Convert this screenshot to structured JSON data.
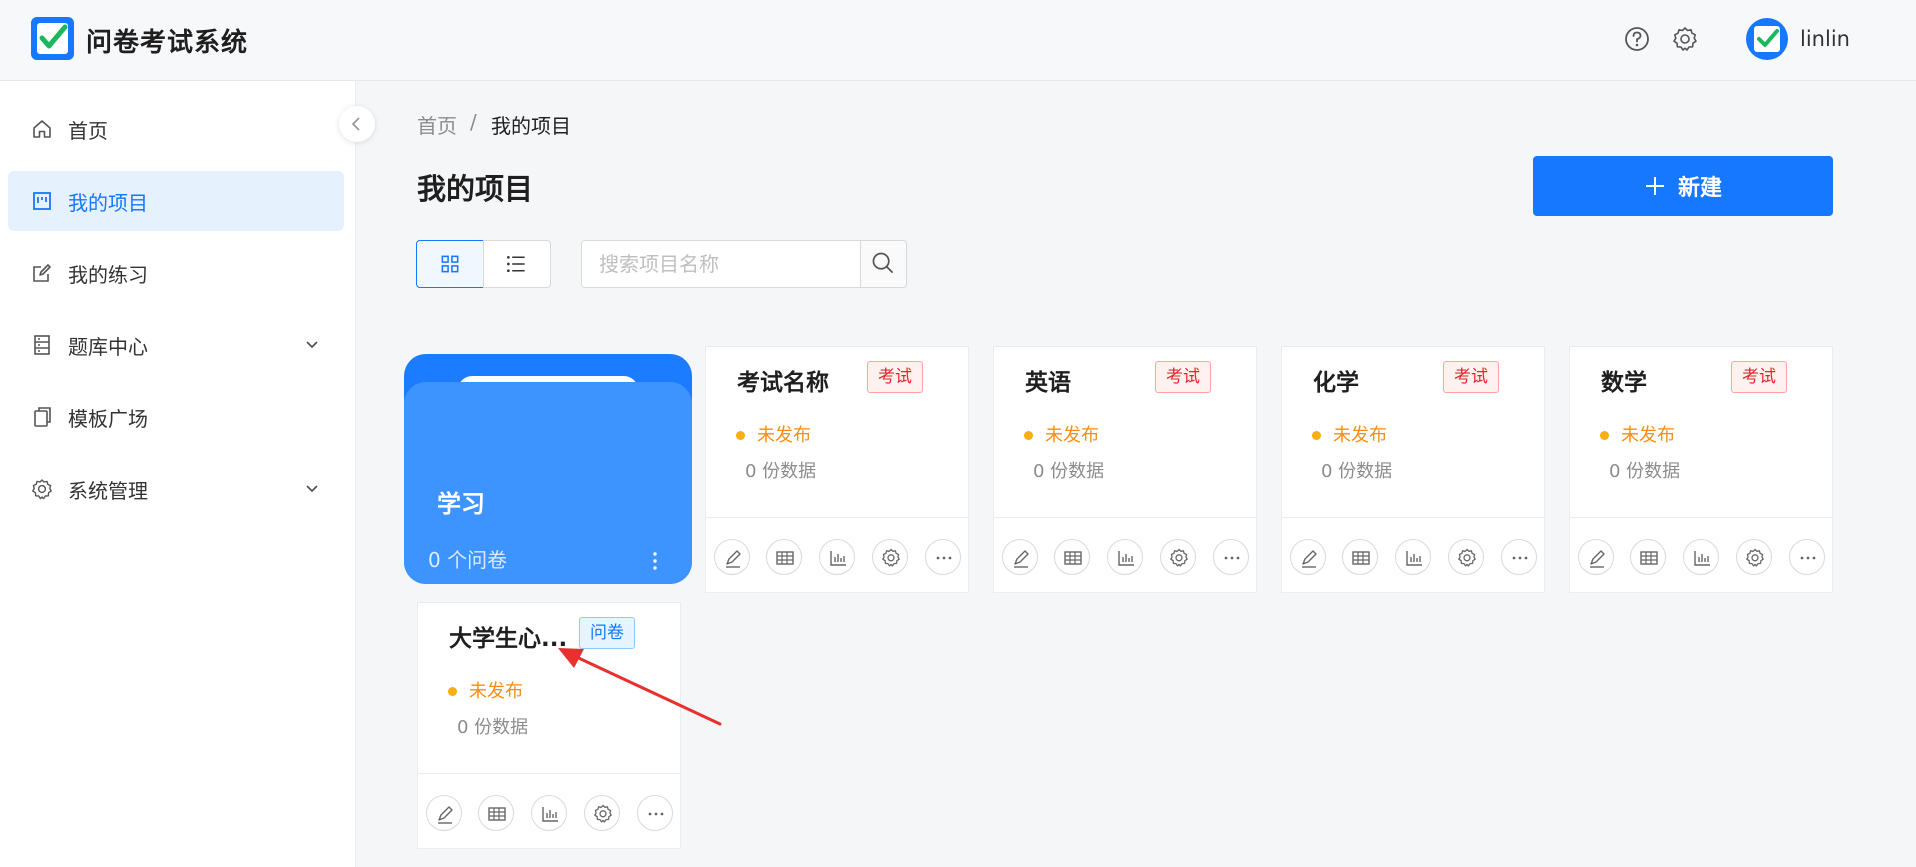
{
  "app": {
    "title": "问卷考试系统",
    "user": "linlin"
  },
  "colors": {
    "primary": "#1677ff",
    "exam_tag": "#e2252d",
    "survey_tag": "#1677ff",
    "status_draft": "#fa8c16"
  },
  "sidebar": {
    "items": [
      {
        "label": "首页",
        "icon": "home-icon"
      },
      {
        "label": "我的项目",
        "icon": "project-board-icon",
        "active": true
      },
      {
        "label": "我的练习",
        "icon": "edit-note-icon"
      },
      {
        "label": "题库中心",
        "icon": "database-icon",
        "expandable": true
      },
      {
        "label": "模板广场",
        "icon": "copy-template-icon"
      },
      {
        "label": "系统管理",
        "icon": "gear-icon",
        "expandable": true
      }
    ]
  },
  "breadcrumb": {
    "home": "首页",
    "separator": "/",
    "current": "我的项目"
  },
  "page": {
    "title": "我的项目",
    "new_button": "新建",
    "search_placeholder": "搜索项目名称"
  },
  "folder": {
    "name": "学习",
    "count": "0 个问卷"
  },
  "projects": [
    {
      "title": "考试名称",
      "tag": "考试",
      "status": "未发布",
      "count": "0  份数据"
    },
    {
      "title": "英语",
      "tag": "考试",
      "status": "未发布",
      "count": "0  份数据"
    },
    {
      "title": "化学",
      "tag": "考试",
      "status": "未发布",
      "count": "0  份数据"
    },
    {
      "title": "数学",
      "tag": "考试",
      "status": "未发布",
      "count": "0  份数据"
    },
    {
      "title": "大学生心...",
      "tag": "问卷",
      "status": "未发布",
      "count": "0  份数据"
    }
  ],
  "card_actions": [
    "edit-icon",
    "table-icon",
    "chart-icon",
    "settings-icon",
    "more-icon"
  ]
}
